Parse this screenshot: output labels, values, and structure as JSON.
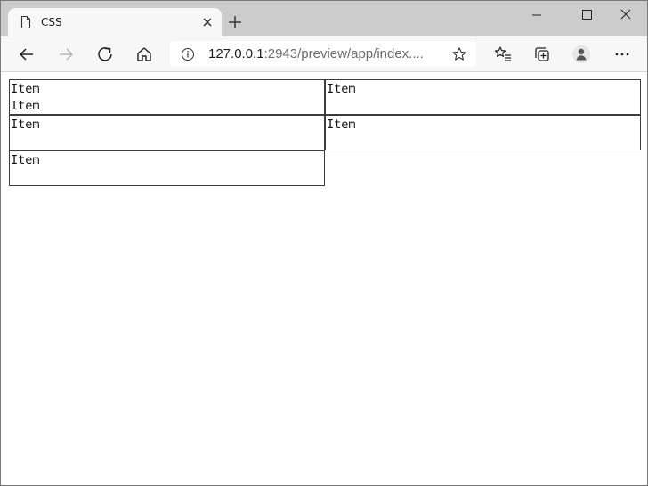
{
  "browser": {
    "tab_title": "CSS",
    "address": {
      "host": "127.0.0.1",
      "rest": ":2943/preview/app/index...."
    }
  },
  "content": {
    "cells": [
      [
        "Item",
        "Item"
      ],
      [
        "Item"
      ],
      [
        "Item"
      ],
      [
        "Item"
      ],
      [
        "Item"
      ]
    ]
  },
  "icons": {
    "tab": "page-icon",
    "close": "close-icon",
    "new_tab": "plus-icon",
    "back": "back-arrow-icon",
    "forward": "forward-arrow-icon",
    "refresh": "refresh-icon",
    "home": "home-icon",
    "info": "info-icon",
    "star": "star-icon",
    "favorites": "favorites-icon",
    "collections": "collections-icon",
    "profile": "profile-icon",
    "more": "more-icon"
  }
}
